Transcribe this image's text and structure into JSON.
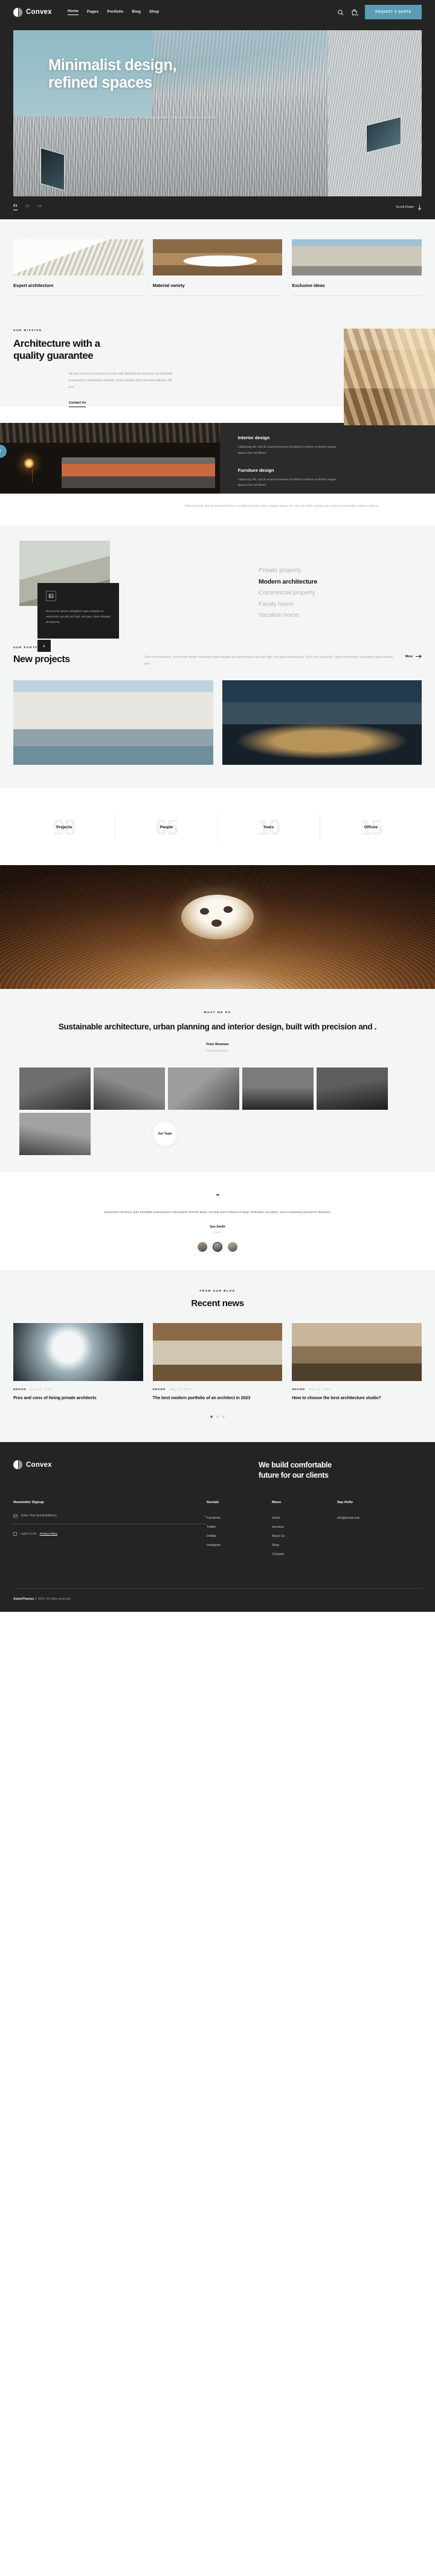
{
  "header": {
    "brand": "Convex",
    "nav": [
      {
        "label": "Home",
        "active": true
      },
      {
        "label": "Pages",
        "active": false
      },
      {
        "label": "Portfolio",
        "active": false
      },
      {
        "label": "Blog",
        "active": false
      },
      {
        "label": "Shop",
        "active": false
      }
    ],
    "search_icon": "search-icon",
    "cart_icon": "cart-icon",
    "quote_button": "REQUEST A QUOTE",
    "accent_color": "#5b9bb5",
    "background": "#242424"
  },
  "hero": {
    "title_line1": "Minimalist design,",
    "title_line2": "refined spaces",
    "subtitle": "Architecto beatae vitae dicta sunt explicabo. Nemo enim ipsam voluptatem.",
    "slides": [
      "01",
      "02",
      "03"
    ],
    "active_slide": "01",
    "scroll_label": "Scroll Down"
  },
  "features": [
    {
      "title": "Expert architecture"
    },
    {
      "title": "Material variety"
    },
    {
      "title": "Exclusive ideas"
    }
  ],
  "mission": {
    "eyebrow": "OUR MISSION",
    "title_line1": "Architecture with a",
    "title_line2": "quality guarantee",
    "paragraph": "At vero eos et accusamus et iusto odio dignissimos ducimus qui blanditiis praesentium voluptatum deleniti. Lorem ipsum dolor sit amet adipscin elit pro.",
    "link": "Contact Us",
    "badge_number": "1",
    "services": [
      {
        "title": "Interior design",
        "desc": "Adipiscing elit, sed do eiusmod tempor incididunt ut labore et dolore magna aliqua enim ad labore."
      },
      {
        "title": "Furniture design",
        "desc": "Adipiscing elit, sed do eiusmod tempor incididunt ut labore et dolore magna aliqua enim ad labore."
      }
    ],
    "footnote": "Adipiscing elit, sed do eiusmod tempor incididunt labore dolore magna aliqua. Ut enim ad minim veniam quis nostrud exercitation ullamco laboris."
  },
  "architecture": {
    "card_icon": "image-icon",
    "card_text": "Nemo enim ipsam voluptatem quia voluptas sit aspernatur aut odit aut fugit, sed quia. Quia voluptas sit asperna.",
    "plus_label": "+",
    "list": [
      {
        "label": "Private property",
        "active": false
      },
      {
        "label": "Modern architecture",
        "active": true
      },
      {
        "label": "Commercial property",
        "active": false
      },
      {
        "label": "Family home",
        "active": false
      },
      {
        "label": "Vacation home",
        "active": false
      }
    ]
  },
  "portfolio": {
    "eyebrow": "OUR PORTFOLIO",
    "title": "New projects",
    "description": "Dicta sunt explicabo. Nemo enim ipsam voluptatem quia voluptas sit aspernaturaut odit aut fugit, sed quia consequuntur. Dicta sunt explicabo. Nemo enim ipsam voluptatem quia voluptas sunt.",
    "more_label": "More"
  },
  "stats": [
    {
      "value": "98",
      "label": "Projects"
    },
    {
      "value": "65",
      "label": "People"
    },
    {
      "value": "10",
      "label": "Years"
    },
    {
      "value": "15",
      "label": "Offices"
    }
  ],
  "what_we_do": {
    "eyebrow": "WHAT WE DO",
    "headline": "Sustainable architecture, urban planning and interior design, built with precision and .",
    "name": "Peter Bowman",
    "role": "Creative Director",
    "team_badge": "Our Team"
  },
  "testimonial": {
    "quote_mark": "”",
    "quote": "Ignissimos ducimus quin blanditiis praesentium voluptatem deleniti atque corrupti quos dolores et quas molestias excepturi, sunt occaecanti gnissimos ducimus.",
    "name": "Sue Smith",
    "role": "Client"
  },
  "blog": {
    "eyebrow": "FROM OUR BLOG",
    "title": "Recent news",
    "posts": [
      {
        "category": "DESIGN",
        "date": "May 24, 2023",
        "title": "Pros and cons of hiring private architects"
      },
      {
        "category": "DESIGN",
        "date": "May 24, 2023",
        "title": "The best modern portfolio of an architect in 2023"
      },
      {
        "category": "DESIGN",
        "date": "May 24, 2023",
        "title": "How to choose the best architecture studio?"
      }
    ],
    "dots": 3,
    "active_dot": 0
  },
  "footer": {
    "brand": "Convex",
    "claim_line1": "We build comfortable",
    "claim_line2": "future for our clients",
    "newsletter": {
      "heading": "Newsletter Signup",
      "placeholder": "Enter Your Email Address",
      "value": "",
      "submit_icon": "arrow-right-icon",
      "consent_prefix": "I agree to the ",
      "consent_link": "Privacy Policy"
    },
    "columns": [
      {
        "heading": "Socials",
        "items": [
          "Facebook",
          "Twitter",
          "Dribble",
          "Instagram"
        ]
      },
      {
        "heading": "Menu",
        "items": [
          "Home",
          "Services",
          "About Us",
          "Shop",
          "Contacts"
        ]
      },
      {
        "heading": "Say Hello",
        "items": [
          "info@email.com"
        ]
      }
    ],
    "copyright_brand": "AxiomThemes",
    "copyright_rest": " © 2023. All rights reserved."
  }
}
